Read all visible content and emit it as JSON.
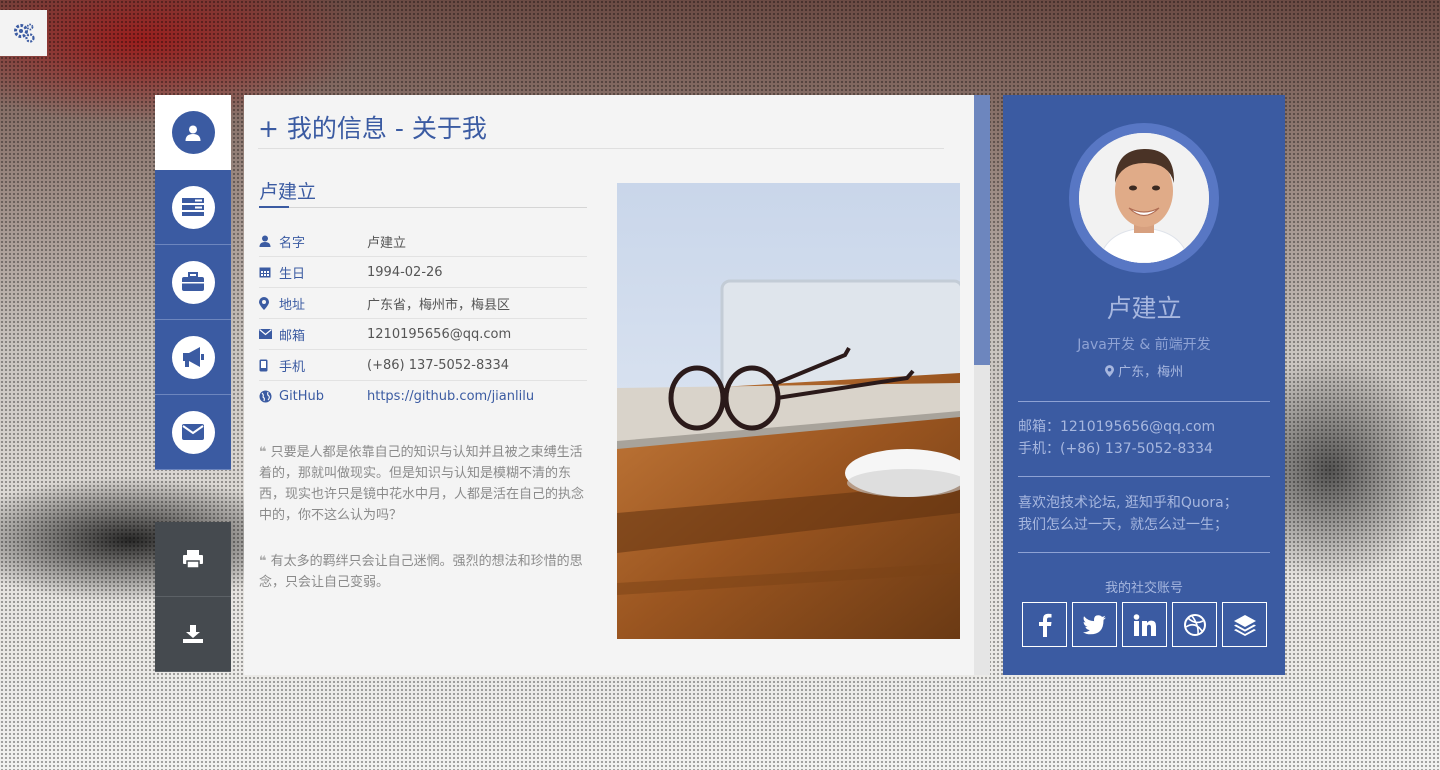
{
  "page": {
    "title_prefix": "+",
    "title": "我的信息 - 关于我"
  },
  "nav": {
    "items": [
      {
        "icon": "user-icon",
        "active": true
      },
      {
        "icon": "list-icon",
        "active": false
      },
      {
        "icon": "briefcase-icon",
        "active": false
      },
      {
        "icon": "megaphone-icon",
        "active": false
      },
      {
        "icon": "envelope-icon",
        "active": false
      }
    ],
    "tools": [
      {
        "icon": "print-icon"
      },
      {
        "icon": "download-icon"
      }
    ]
  },
  "profile": {
    "name": "卢建立",
    "fields": [
      {
        "icon": "user-icon",
        "label": "名字",
        "value": "卢建立"
      },
      {
        "icon": "calendar-icon",
        "label": "生日",
        "value": "1994-02-26"
      },
      {
        "icon": "map-marker-icon",
        "label": "地址",
        "value": "广东省，梅州市，梅县区"
      },
      {
        "icon": "envelope-icon",
        "label": "邮箱",
        "value": "1210195656@qq.com"
      },
      {
        "icon": "mobile-icon",
        "label": "手机",
        "value": "(+86) 137-5052-8334"
      },
      {
        "icon": "globe-icon",
        "label": "GitHub",
        "value": "https://github.com/jianlilu"
      }
    ],
    "quotes": [
      "只要是人都是依靠自己的知识与认知并且被之束缚生活着的，那就叫做现实。但是知识与认知是模糊不清的东西，现实也许只是镜中花水中月，人都是活在自己的执念中的，你不这么认为吗？",
      "有太多的羁绊只会让自己迷惘。强烈的想法和珍惜的思念，只会让自己变弱。"
    ]
  },
  "card": {
    "name": "卢建立",
    "role": "Java开发 & 前端开发",
    "location": "广东，梅州",
    "email_line": "邮箱：1210195656@qq.com",
    "phone_line": "手机：(+86) 137-5052-8334",
    "hobby_line1": "喜欢泡技术论坛, 逛知乎和Quora；",
    "hobby_line2": "我们怎么过一天，就怎么过一生；",
    "social_label": "我的社交账号",
    "socials": [
      "facebook-icon",
      "twitter-icon",
      "linkedin-icon",
      "dribbble-icon",
      "stack-icon"
    ]
  },
  "colors": {
    "accent": "#3b5ba2",
    "nav_dark": "#454a4f"
  }
}
